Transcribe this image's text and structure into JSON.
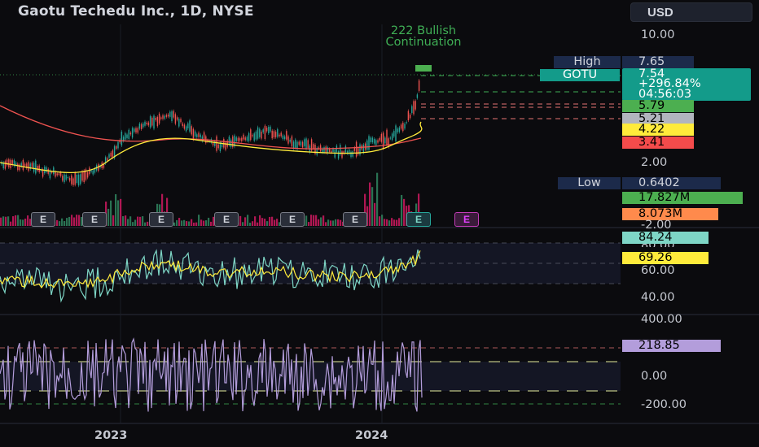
{
  "header": {
    "title": "Gaotu Techedu Inc., 1D, NYSE",
    "currency": "USD"
  },
  "annotation": {
    "line1": "222 Bullish",
    "line2": "Continuation"
  },
  "price_axis": [
    "10.00",
    "2.00"
  ],
  "tags": {
    "high": {
      "name": "High",
      "value": "7.65"
    },
    "symbol": {
      "name": "GOTU",
      "price": "7.54",
      "change": "+296.84%",
      "countdown": "04:56:03"
    },
    "levels": [
      {
        "value": "5.79",
        "color": "#4caf50"
      },
      {
        "value": "5.21",
        "color": "#b2b5be"
      },
      {
        "value": "4.22",
        "color": "#ffeb3b"
      },
      {
        "value": "3.41",
        "color": "#f44b4b"
      }
    ],
    "low": {
      "name": "Low",
      "value": "0.6402"
    },
    "volume": [
      {
        "value": "17.827M",
        "color": "#4caf50"
      },
      {
        "value": "8.073M",
        "color": "#ff8a4c"
      }
    ]
  },
  "volume_axis": "-2.00",
  "earnings_label": "E",
  "rsi": {
    "axis": [
      "60.00",
      "40.00"
    ],
    "partial_top": "80.00",
    "value1": "84.24",
    "value2": "69.26"
  },
  "cci": {
    "axis": [
      "400.00",
      "0.00",
      "-200.00"
    ],
    "value": "218.85"
  },
  "time_axis": [
    "2023",
    "2024"
  ],
  "colors": {
    "background": "#0b0b0e",
    "up": "#26a69a",
    "down": "#ef5350",
    "ma_slow": "#ef5350",
    "ma_fast": "#ffeb3b",
    "rsi": "#7ed6c6",
    "cci": "#b39ddb",
    "annotation": "#3fae55"
  },
  "chart_data": [
    {
      "type": "line",
      "title": "Gaotu Techedu Inc., 1D, NYSE",
      "ylim": [
        0.6402,
        7.65
      ],
      "x": [
        "2023",
        "2024"
      ],
      "series": [
        {
          "name": "GOTU",
          "values": [
            0.6402,
            7.54
          ]
        }
      ]
    }
  ]
}
